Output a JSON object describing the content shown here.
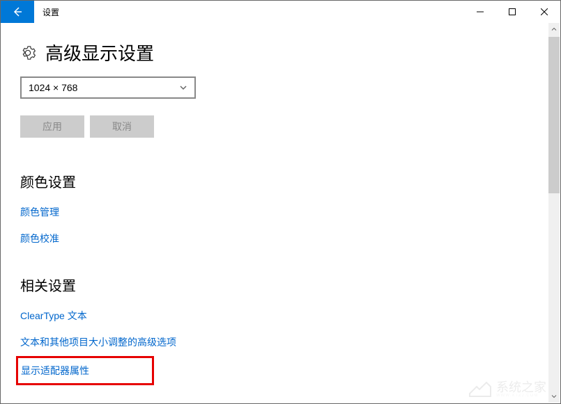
{
  "titlebar": {
    "title": "设置"
  },
  "header": {
    "title": "高级显示设置"
  },
  "resolution": {
    "selected": "1024 × 768"
  },
  "buttons": {
    "apply": "应用",
    "cancel": "取消"
  },
  "sections": {
    "color": {
      "title": "颜色设置",
      "links": {
        "color_management": "颜色管理",
        "color_calibration": "颜色校准"
      }
    },
    "related": {
      "title": "相关设置",
      "links": {
        "cleartype": "ClearType 文本",
        "text_sizing": "文本和其他项目大小调整的高级选项",
        "adapter": "显示适配器属性"
      }
    }
  },
  "watermark": {
    "text": "系统之家",
    "sub": "WWW.XTZJ.COM"
  }
}
